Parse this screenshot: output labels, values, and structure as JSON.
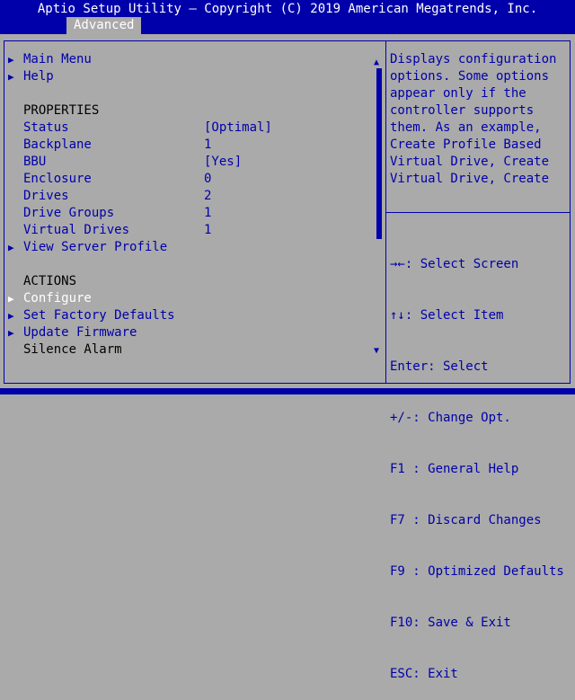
{
  "header": {
    "title": "Aptio Setup Utility – Copyright (C) 2019 American Megatrends, Inc.",
    "active_tab": "Advanced"
  },
  "menu": {
    "main_menu": "Main Menu",
    "help": "Help",
    "properties_heading": "PROPERTIES",
    "properties": [
      {
        "label": "Status",
        "value": "[Optimal]"
      },
      {
        "label": "Backplane",
        "value": "1"
      },
      {
        "label": "BBU",
        "value": "[Yes]"
      },
      {
        "label": "Enclosure",
        "value": "0"
      },
      {
        "label": "Drives",
        "value": "2"
      },
      {
        "label": "Drive Groups",
        "value": "1"
      },
      {
        "label": "Virtual Drives",
        "value": "1"
      }
    ],
    "view_server_profile": "View Server Profile",
    "actions_heading": "ACTIONS",
    "actions": {
      "configure": "Configure",
      "set_factory_defaults": "Set Factory Defaults",
      "update_firmware": "Update Firmware",
      "silence_alarm": "Silence Alarm"
    }
  },
  "help_text": "Displays configuration\noptions. Some options\nappear only if the\ncontroller supports\nthem. As an example,\nCreate Profile Based\nVirtual Drive, Create\nVirtual Drive, Create",
  "key_legend": [
    "→←: Select Screen",
    "↑↓: Select Item",
    "Enter: Select",
    "+/-: Change Opt.",
    "F1 : General Help",
    "F7 : Discard Changes",
    "F9 : Optimized Defaults",
    "F10: Save & Exit",
    "ESC: Exit"
  ],
  "colors": {
    "background": "#aaaaaa",
    "accent": "#0000aa",
    "selected_text": "#ffffff",
    "static_text": "#000000"
  },
  "icons": {
    "submenu": "triangle-right-icon",
    "scroll_up": "triangle-up-icon",
    "scroll_down": "triangle-down-icon"
  }
}
